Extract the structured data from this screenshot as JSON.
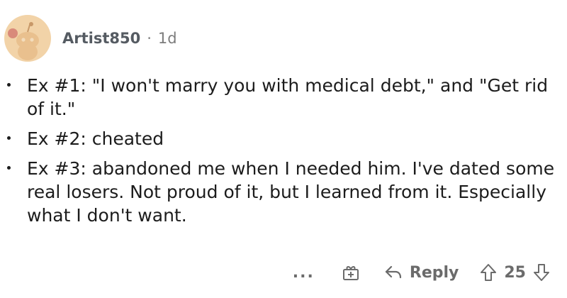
{
  "comment": {
    "username": "Artist850",
    "separator": "·",
    "age": "1d",
    "items": [
      {
        "text": "Ex #1: \"I won't marry you with medical debt,\" and \"Get rid of it.\""
      },
      {
        "text": "Ex #2: cheated"
      },
      {
        "text": "Ex #3: abandoned me when I needed him. I've dated some real losers. Not proud of it, but I learned from it. Especially what I don't want."
      }
    ]
  },
  "actions": {
    "more_label": "...",
    "reply_label": "Reply",
    "vote_count": "25"
  },
  "icons": {
    "avatar": "snoo-avatar-icon",
    "award": "award-gift-icon",
    "reply": "reply-arrow-icon",
    "upvote": "upvote-arrow-icon",
    "downvote": "downvote-arrow-icon"
  },
  "colors": {
    "avatar_bg": "#f2d3a8",
    "text": "#1c1c1c",
    "muted": "#7c7c7c"
  }
}
